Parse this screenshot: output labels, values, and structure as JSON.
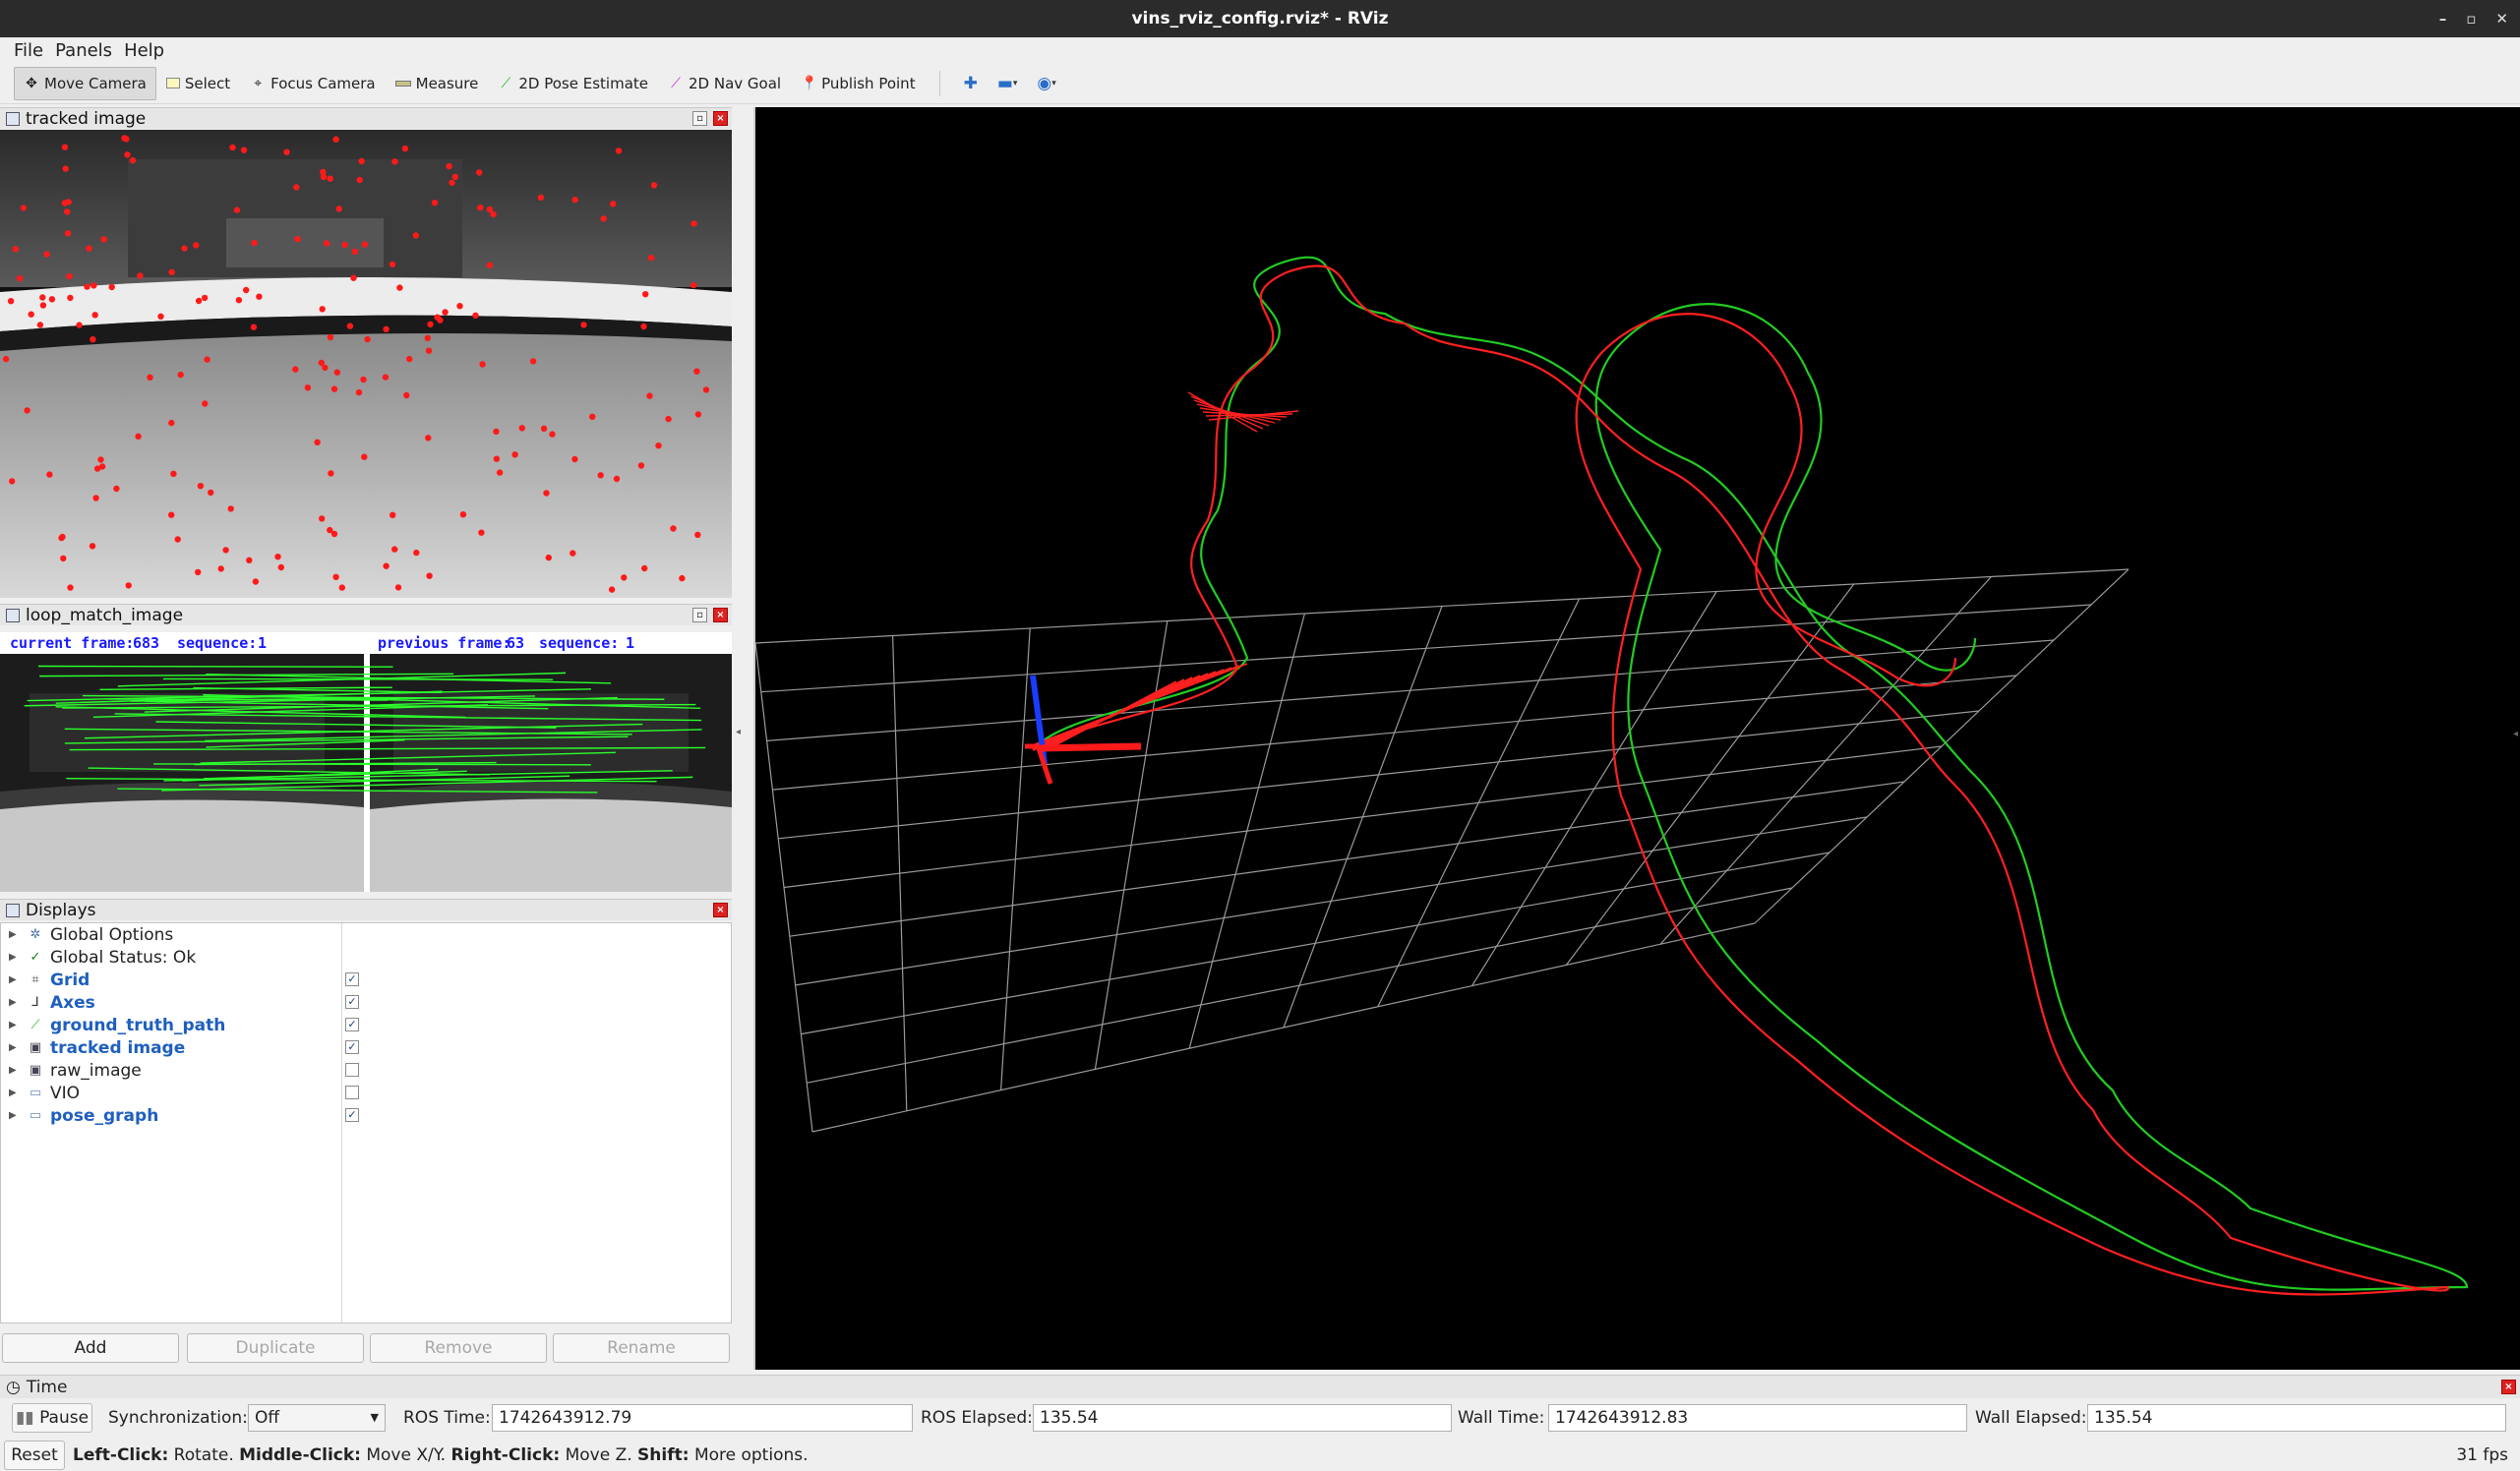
{
  "window": {
    "title": "vins_rviz_config.rviz* - RViz",
    "controls": [
      "–",
      "▫",
      "✕"
    ]
  },
  "menu": [
    {
      "label": "File"
    },
    {
      "label": "Panels"
    },
    {
      "label": "Help"
    }
  ],
  "toolbar": {
    "move_camera": "Move Camera",
    "select": "Select",
    "focus_camera": "Focus Camera",
    "measure": "Measure",
    "pose_estimate": "2D Pose Estimate",
    "nav_goal": "2D Nav Goal",
    "publish_point": "Publish Point"
  },
  "tracked_image": {
    "title": "tracked image"
  },
  "loop_match": {
    "title": "loop_match_image",
    "current_label": "current frame:",
    "current_frame": "683",
    "current_seq_label": "sequence:",
    "current_seq": "1",
    "previous_label": "previous frame:",
    "previous_frame": "63",
    "previous_seq_label": "sequence:",
    "previous_seq": "1"
  },
  "displays": {
    "title": "Displays",
    "items": [
      {
        "label": "Global Options",
        "icon": "gear-icon",
        "bold": false,
        "checkbox": null
      },
      {
        "label": "Global Status: Ok",
        "icon": "check-icon",
        "bold": false,
        "checkbox": null
      },
      {
        "label": "Grid",
        "icon": "grid-icon",
        "bold": true,
        "checkbox": true
      },
      {
        "label": "Axes",
        "icon": "axes-icon",
        "bold": true,
        "checkbox": true
      },
      {
        "label": "ground_truth_path",
        "icon": "path-icon",
        "bold": true,
        "checkbox": true
      },
      {
        "label": "tracked image",
        "icon": "image-icon",
        "bold": true,
        "checkbox": true
      },
      {
        "label": "raw_image",
        "icon": "image-icon",
        "bold": false,
        "checkbox": false
      },
      {
        "label": "VIO",
        "icon": "folder-icon",
        "bold": false,
        "checkbox": false
      },
      {
        "label": "pose_graph",
        "icon": "folder-icon",
        "bold": true,
        "checkbox": true
      }
    ],
    "buttons": {
      "add": "Add",
      "duplicate": "Duplicate",
      "remove": "Remove",
      "rename": "Rename"
    }
  },
  "time": {
    "title": "Time",
    "pause": "Pause",
    "sync_label": "Synchronization:",
    "sync_value": "Off",
    "ros_time_label": "ROS Time:",
    "ros_time": "1742643912.79",
    "ros_elapsed_label": "ROS Elapsed:",
    "ros_elapsed": "135.54",
    "wall_time_label": "Wall Time:",
    "wall_time": "1742643912.83",
    "wall_elapsed_label": "Wall Elapsed:",
    "wall_elapsed": "135.54"
  },
  "status": {
    "reset": "Reset",
    "left_click": "Left-Click:",
    "left_click_desc": "Rotate.",
    "middle_click": "Middle-Click:",
    "middle_click_desc": "Move X/Y.",
    "right_click": "Right-Click:",
    "right_click_desc": "Move Z.",
    "shift": "Shift:",
    "shift_desc": "More options.",
    "fps": "31 fps"
  },
  "colors": {
    "ground_truth": "#22cc22",
    "estimate": "#ff2020",
    "axis_z": "#1a3cff",
    "feature": "#ff1a1a",
    "match_line": "#2cff2c"
  }
}
